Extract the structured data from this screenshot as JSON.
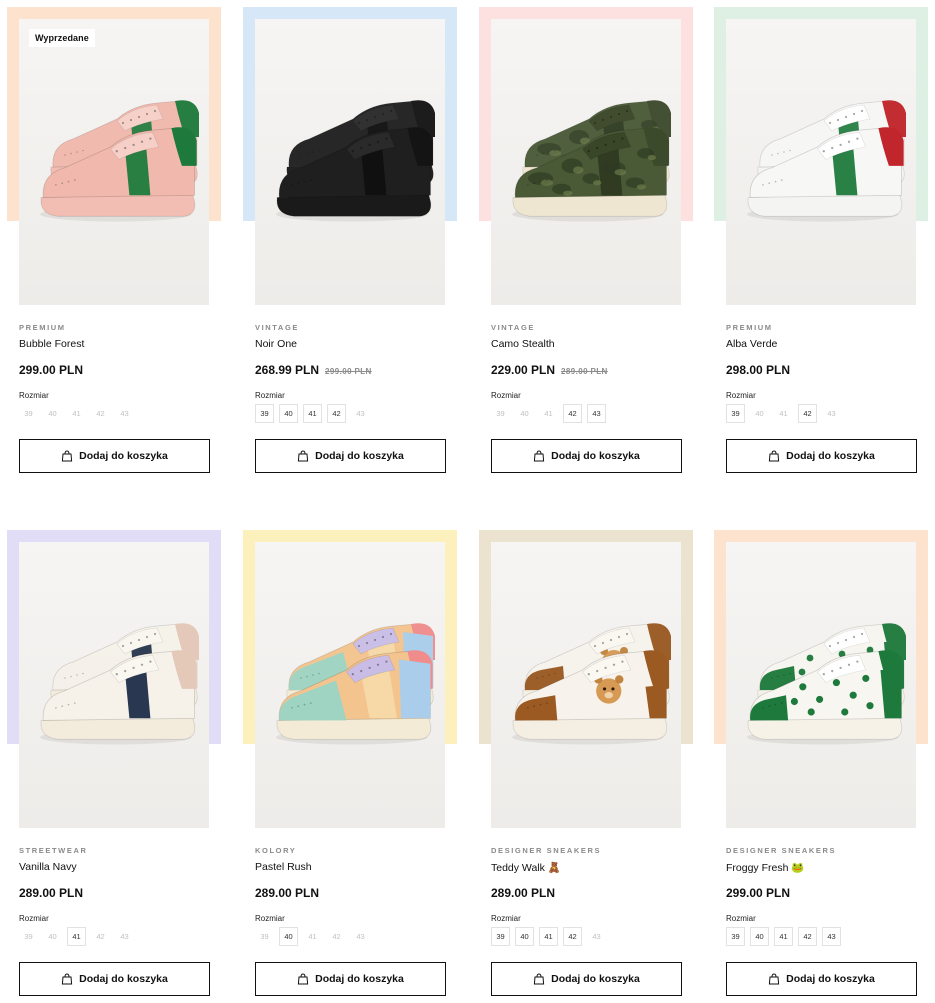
{
  "products": [
    {
      "badge": "Wyprzedane",
      "category": "PREMIUM",
      "name": "Bubble Forest",
      "price": "299.00 PLN",
      "old_price": "",
      "size_label": "Rozmiar",
      "sizes": [
        "39",
        "40",
        "41",
        "42",
        "43"
      ],
      "available": [],
      "bg_color": "#fde2ce",
      "shoe": {
        "upper": "#f1b8ad",
        "accent": "#1e7a3c",
        "heel": "#1e7a3c",
        "sole": "#f2bdb2",
        "lace": "#f6d0c8",
        "style": "stripe"
      },
      "button_label": "Dodaj do koszyka"
    },
    {
      "badge": "",
      "category": "VINTAGE",
      "name": "Noir One",
      "price": "268.99 PLN",
      "old_price": "299.00 PLN",
      "size_label": "Rozmiar",
      "sizes": [
        "39",
        "40",
        "41",
        "42",
        "43"
      ],
      "available": [
        "39",
        "40",
        "41",
        "42"
      ],
      "bg_color": "#d6e8f8",
      "shoe": {
        "upper": "#1f1f1f",
        "accent": "#101010",
        "heel": "#141414",
        "sole": "#1a1a1a",
        "lace": "#2a2a2a",
        "style": "stripe"
      },
      "button_label": "Dodaj do koszyka"
    },
    {
      "badge": "",
      "category": "VINTAGE",
      "name": "Camo Stealth",
      "price": "229.00 PLN",
      "old_price": "289.00 PLN",
      "size_label": "Rozmiar",
      "sizes": [
        "39",
        "40",
        "41",
        "42",
        "43"
      ],
      "available": [
        "42",
        "43"
      ],
      "bg_color": "#fde0e0",
      "shoe": {
        "upper": "#4a5a36",
        "accent": "#2e3a22",
        "heel": "#3c4a2c",
        "sole": "#efe6d2",
        "lace": "#3a4628",
        "style": "camo"
      },
      "button_label": "Dodaj do koszyka"
    },
    {
      "badge": "",
      "category": "PREMIUM",
      "name": "Alba Verde",
      "price": "298.00 PLN",
      "old_price": "",
      "size_label": "Rozmiar",
      "sizes": [
        "39",
        "40",
        "41",
        "42",
        "43"
      ],
      "available": [
        "39",
        "42"
      ],
      "bg_color": "#ddf0e3",
      "shoe": {
        "upper": "#f7f7f5",
        "accent": "#1e7a3c",
        "heel": "#c0262b",
        "sole": "#f4f4f2",
        "lace": "#ffffff",
        "style": "stripe"
      },
      "button_label": "Dodaj do koszyka"
    },
    {
      "badge": "",
      "category": "STREETWEAR",
      "name": "Vanilla Navy",
      "price": "289.00 PLN",
      "old_price": "",
      "size_label": "Rozmiar",
      "sizes": [
        "39",
        "40",
        "41",
        "42",
        "43"
      ],
      "available": [
        "41"
      ],
      "bg_color": "#e2ddf6",
      "shoe": {
        "upper": "#f6f2ea",
        "accent": "#1e2d48",
        "heel": "#e4c8b8",
        "sole": "#f3ecdc",
        "lace": "#faf7f0",
        "style": "stripe"
      },
      "button_label": "Dodaj do koszyka"
    },
    {
      "badge": "",
      "category": "KOLORY",
      "name": "Pastel Rush",
      "price": "289.00 PLN",
      "old_price": "",
      "size_label": "Rozmiar",
      "sizes": [
        "39",
        "40",
        "41",
        "42",
        "43"
      ],
      "available": [
        "40"
      ],
      "bg_color": "#fcf1bd",
      "shoe": {
        "upper": "#f4c48e",
        "accent": "#9fd3c2",
        "heel": "#f08c8c",
        "sole": "#f3ebd6",
        "lace": "#c9bde6",
        "style": "pastel"
      },
      "button_label": "Dodaj do koszyka"
    },
    {
      "badge": "",
      "category": "DESIGNER SNEAKERS",
      "name": "Teddy Walk 🧸",
      "price": "289.00 PLN",
      "old_price": "",
      "size_label": "Rozmiar",
      "sizes": [
        "39",
        "40",
        "41",
        "42",
        "43"
      ],
      "available": [
        "39",
        "40",
        "41",
        "42"
      ],
      "bg_color": "#ece2d0",
      "shoe": {
        "upper": "#f7f3ec",
        "accent": "#9a5a22",
        "heel": "#9a5a22",
        "sole": "#f5efe3",
        "lace": "#fbf8f2",
        "style": "teddy"
      },
      "button_label": "Dodaj do koszyka"
    },
    {
      "badge": "",
      "category": "DESIGNER SNEAKERS",
      "name": "Froggy Fresh 🐸",
      "price": "299.00 PLN",
      "old_price": "",
      "size_label": "Rozmiar",
      "sizes": [
        "39",
        "40",
        "41",
        "42",
        "43"
      ],
      "available": [
        "39",
        "40",
        "41",
        "42",
        "43"
      ],
      "bg_color": "#fde2ce",
      "shoe": {
        "upper": "#f8f6f0",
        "accent": "#1e7a3c",
        "heel": "#1e7a3c",
        "sole": "#f6f2e8",
        "lace": "#ffffff",
        "style": "froggy"
      },
      "button_label": "Dodaj do koszyka"
    }
  ]
}
